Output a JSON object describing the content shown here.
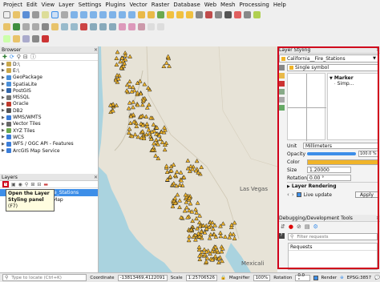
{
  "menubar": [
    "Project",
    "Edit",
    "View",
    "Layer",
    "Settings",
    "Plugins",
    "Vector",
    "Raster",
    "Database",
    "Web",
    "Mesh",
    "Processing",
    "Help"
  ],
  "browser": {
    "title": "Browser",
    "items": [
      {
        "label": "D:\\",
        "icon_color": "#c9a74a"
      },
      {
        "label": "E:\\",
        "icon_color": "#c9a74a"
      },
      {
        "label": "GeoPackage",
        "icon_color": "#4a8fd9"
      },
      {
        "label": "SpatiaLite",
        "icon_color": "#4a8fd9"
      },
      {
        "label": "PostGIS",
        "icon_color": "#3366aa"
      },
      {
        "label": "MSSQL",
        "icon_color": "#777"
      },
      {
        "label": "Oracle",
        "icon_color": "#c0392b"
      },
      {
        "label": "DB2",
        "icon_color": "#555"
      },
      {
        "label": "WMS/WMTS",
        "icon_color": "#3b7dd8"
      },
      {
        "label": "Vector Tiles",
        "icon_color": "#666"
      },
      {
        "label": "XYZ Tiles",
        "icon_color": "#6aa84f"
      },
      {
        "label": "WCS",
        "icon_color": "#3b7dd8"
      },
      {
        "label": "WFS / OGC API - Features",
        "icon_color": "#3b7dd8"
      },
      {
        "label": "ArcGIS Map Service",
        "icon_color": "#3b7dd8"
      }
    ]
  },
  "layers": {
    "title": "Layers",
    "items": [
      {
        "label": "Fire_Stations",
        "selected": true
      },
      {
        "label": "etMap",
        "selected": false
      }
    ],
    "tooltip_line1": "Open the Layer",
    "tooltip_line2": "Styling panel",
    "tooltip_shortcut": "(F7)"
  },
  "map_labels": [
    {
      "text": "Las Vegas"
    },
    {
      "text": "Mexicali"
    }
  ],
  "layer_styling": {
    "title": "Layer Styling",
    "layer_name": "California__Fire_Stations",
    "renderer": "Single symbol",
    "tree_root": "Marker",
    "tree_child": "Simp...",
    "unit_label": "Unit",
    "unit_value": "Millimeters",
    "opacity_label": "Opacity",
    "opacity_value": "100.0 %",
    "opacity_fraction": 1.0,
    "color_label": "Color",
    "color_value": "#f0b429",
    "size_label": "Size",
    "size_value": "1.20000",
    "rotation_label": "Rotation",
    "rotation_value": "0.00 °",
    "layer_rendering": "Layer Rendering",
    "live_update": "Live update",
    "apply": "Apply"
  },
  "debug": {
    "title": "Debugging/Development Tools",
    "filter_placeholder": "Filter requests",
    "requests_header": "Requests"
  },
  "status": {
    "locate_placeholder": "Type to locate (Ctrl+K)",
    "coordinate_label": "Coordinate",
    "coordinate_value": "-13813469,4122091",
    "scale_label": "Scale",
    "scale_value": "1:25706526",
    "magnifier_label": "Magnifier",
    "magnifier_value": "100%",
    "rotation_label": "Rotation",
    "rotation_value": "0.0 °",
    "render_label": "Render",
    "epsg": "EPSG:3857"
  },
  "colors": {
    "accent_red": "#d0021b",
    "marker": "#f0b429",
    "selection": "#3d8ee8"
  }
}
